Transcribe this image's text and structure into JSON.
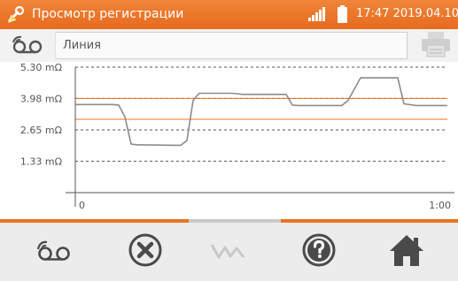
{
  "status_bar": {
    "title": "Просмотр регистрации",
    "datetime": "17:47 2019.04.10",
    "app_icon": "wrench-probe-icon",
    "signal_icon": "signal-icon",
    "battery_icon": "battery-icon"
  },
  "toolbar": {
    "record_icon": "tape-recording-icon",
    "name_value": "Линия",
    "print_icon": "printer-icon"
  },
  "bottom_bar": {
    "buttons": [
      {
        "icon": "tape-recording-icon",
        "enabled": true
      },
      {
        "icon": "close-circle-icon",
        "enabled": true
      },
      {
        "icon": "waveform-icon",
        "enabled": false
      },
      {
        "icon": "help-icon",
        "enabled": true
      },
      {
        "icon": "home-icon",
        "enabled": true
      }
    ]
  },
  "colors": {
    "accent": "#e8731f",
    "plot_line": "#8c8c8c",
    "limit_line": "#e8731f",
    "axis": "#555555",
    "disabled": "#c8c8c8"
  },
  "chart_data": {
    "type": "line",
    "title": "",
    "xlabel": "",
    "ylabel": "",
    "y_tick_labels": [
      "5.30 mΩ",
      "3.98 mΩ",
      "2.65 mΩ",
      "1.33 mΩ"
    ],
    "y_ticks": [
      5.3,
      3.98,
      2.65,
      1.33
    ],
    "x_tick_labels": [
      "0",
      "1:00"
    ],
    "x_ticks": [
      0,
      60
    ],
    "xlim": [
      0,
      60
    ],
    "ylim": [
      0,
      5.3
    ],
    "limit_lines": [
      3.98,
      3.1
    ],
    "series": [
      {
        "x": [
          0,
          6,
          7,
          8,
          9,
          10,
          11,
          16,
          17,
          18,
          19,
          20,
          24,
          25,
          26,
          27,
          34,
          35,
          36,
          43,
          44,
          46,
          48,
          50,
          52,
          53,
          55,
          60
        ],
        "values": [
          3.72,
          3.72,
          3.7,
          3.2,
          2.05,
          2.02,
          2.02,
          2.0,
          2.0,
          2.2,
          3.9,
          4.2,
          4.2,
          4.2,
          4.18,
          4.15,
          4.15,
          3.7,
          3.68,
          3.68,
          3.9,
          4.85,
          4.85,
          4.85,
          4.85,
          3.75,
          3.68,
          3.68
        ]
      }
    ]
  }
}
